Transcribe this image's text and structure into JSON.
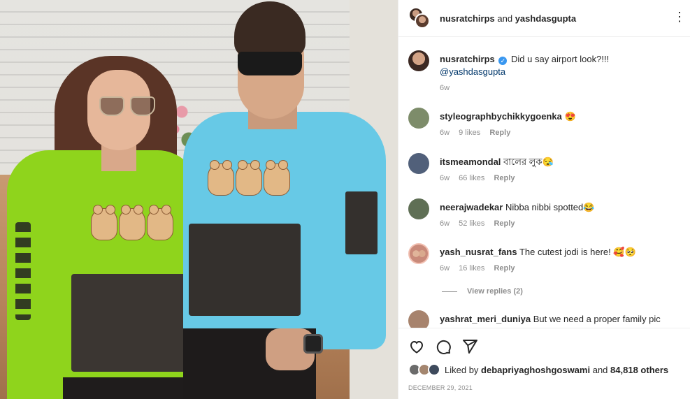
{
  "post": {
    "header_user1": "nusratchirps",
    "header_and": "and",
    "header_user2": "yashdasgupta",
    "more_icon": "⋮",
    "image_alt": "Couple in matching teddy-bear sweatshirts"
  },
  "caption": {
    "user": "nusratchirps",
    "verified_icon": "✓",
    "text": "Did u say airport look?!!!",
    "mention": "@yashdasgupta",
    "time": "6w"
  },
  "comments": [
    {
      "user": "styleographbychikkygoenka",
      "text": "😍",
      "time": "6w",
      "likes": "9 likes",
      "reply": "Reply",
      "avatar_color": "#7d8c6a"
    },
    {
      "user": "itsmeamondal",
      "text": "বালের লুক😪",
      "time": "6w",
      "likes": "66 likes",
      "reply": "Reply",
      "avatar_color": "#51607a"
    },
    {
      "user": "neerajwadekar",
      "text": "Nibba nibbi spotted😂",
      "time": "6w",
      "likes": "52 likes",
      "reply": "Reply",
      "avatar_color": "#5f6f55"
    },
    {
      "user": "yash_nusrat_fans",
      "text": "The cutest jodi is here! 🥰🥺",
      "time": "6w",
      "likes": "16 likes",
      "reply": "Reply",
      "avatar_color": "#c98a7a"
    },
    {
      "user": "yashrat_meri_duniya",
      "text": "But we need a proper family pic",
      "avatar_color": "#a7836d"
    }
  ],
  "view_replies": "View replies (2)",
  "actions": {
    "like_icon": "heart-icon",
    "comment_icon": "comment-icon",
    "share_icon": "share-icon"
  },
  "likes": {
    "prefix": "Liked by",
    "user": "debapriyaghoshgoswami",
    "and": "and",
    "others": "84,818 others"
  },
  "date": "DECEMBER 29, 2021"
}
